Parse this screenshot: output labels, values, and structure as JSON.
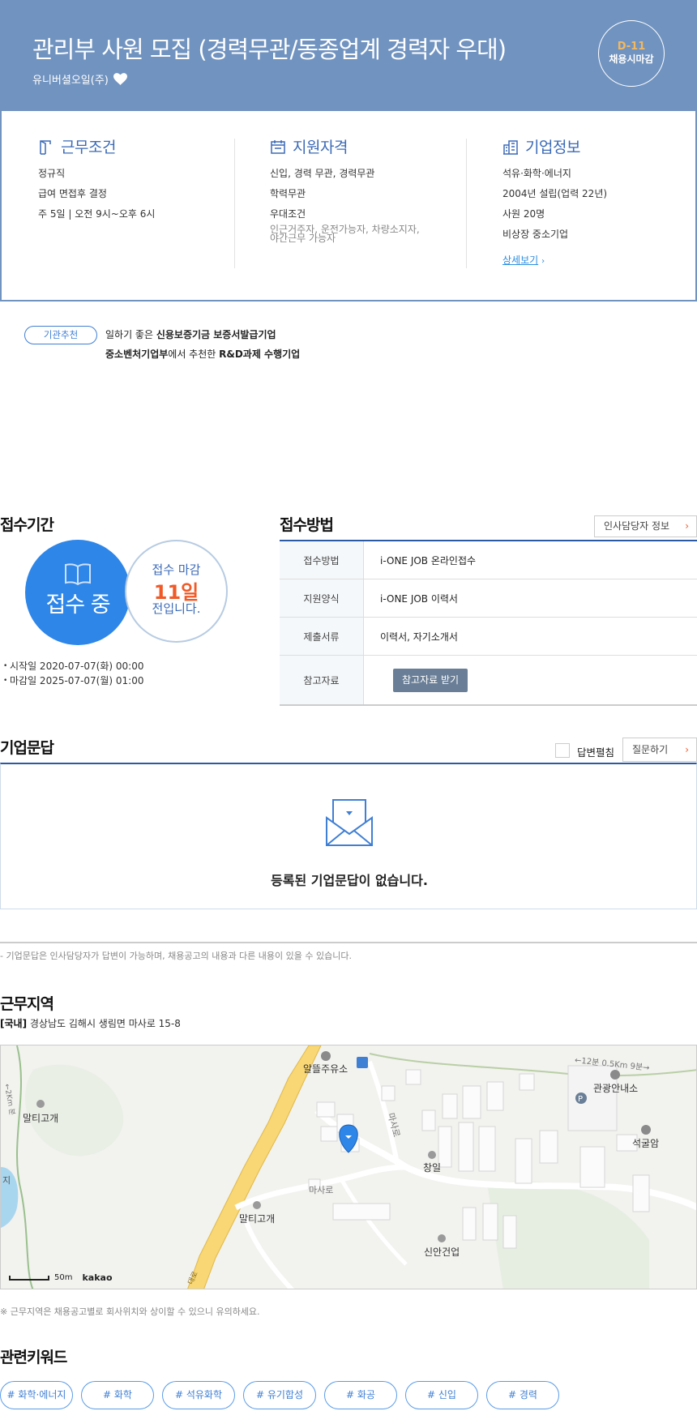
{
  "header": {
    "title": "관리부 사원 모집 (경력무관/동종업계 경력자 우대)",
    "company": "유니버셜오일(주)",
    "dday": "D-11",
    "deadline_type": "채용시마감",
    "bg_color": "#7193c0"
  },
  "info": {
    "work": {
      "title": "근무조건",
      "items": [
        "정규직",
        "급여 면접후 결정",
        "주 5일 | 오전 9시~오후 6시"
      ]
    },
    "qualify": {
      "title": "지원자격",
      "items": [
        "신입, 경력 무관, 경력무관",
        "학력무관",
        "우대조건"
      ],
      "pref_line1": "인근거주자, 운전가능자, 차량소지자,",
      "pref_line2": "야간근무 가능자"
    },
    "company": {
      "title": "기업정보",
      "items": [
        "석유·화학·에너지",
        "2004년 설립(업력 22년)",
        "사원 20명",
        "비상장 중소기업"
      ],
      "detail_link": "상세보기"
    }
  },
  "recommend": {
    "badge": "기관추천",
    "line1_pre": "일하기 좋은 ",
    "line1_bold": "신용보증기금 보증서발급기업",
    "line2_bold1": "중소벤처기업부",
    "line2_mid": "에서 추천한 ",
    "line2_bold2": "R&D과제 수행기업"
  },
  "period": {
    "heading": "접수기간",
    "status": "접수 중",
    "remain_pre": "접수 마감",
    "remain_days": "11일",
    "remain_post": "전입니다.",
    "start": "시작일 2020-07-07(화) 00:00",
    "end": "마감일 2025-07-07(월) 01:00"
  },
  "method": {
    "heading": "접수방법",
    "hr_button": "인사담당자 정보",
    "rows": [
      {
        "k": "접수방법",
        "v": "i-ONE JOB 온라인접수"
      },
      {
        "k": "지원양식",
        "v": "i-ONE JOB 이력서"
      },
      {
        "k": "제출서류",
        "v": "이력서, 자기소개서"
      },
      {
        "k": "참고자료",
        "v": "참고자료 받기"
      }
    ]
  },
  "qa": {
    "heading": "기업문답",
    "toggle_label": "답변펼침",
    "ask_button": "질문하기",
    "empty": "등록된 기업문답이 없습니다.",
    "note": "- 기업문답은 인사담당자가 답변이 가능하며, 채용공고의 내용과 다른 내용이 있을 수 있습니다."
  },
  "location": {
    "heading": "근무지역",
    "region": "[국내]",
    "address": "경상남도 김해시 생림면 마사로 15-8",
    "map_labels": {
      "gas": "알뜰주유소",
      "tour": "관광안내소",
      "maltigogae1": "말티고개",
      "maltigogae2": "말티고개",
      "changil": "창일",
      "seokgulam": "석굴암",
      "sinan": "신안건업",
      "road_masa1": "마사로",
      "road_masa2": "마사로",
      "walk": "←12분 0.5Km 9분→",
      "left_pond": "지",
      "left_walk": "←2Km 분",
      "yellow_road": "대로"
    },
    "scale": "50m",
    "brand": "kakao",
    "note": "※ 근무지역은 채용공고별로 회사위치와 상이할 수 있으니 유의하세요."
  },
  "keywords": {
    "heading": "관련키워드",
    "items": [
      "# 화학·에너지",
      "# 화학",
      "# 석유화학",
      "# 유기합성",
      "# 화공",
      "# 신입",
      "# 경력"
    ]
  }
}
